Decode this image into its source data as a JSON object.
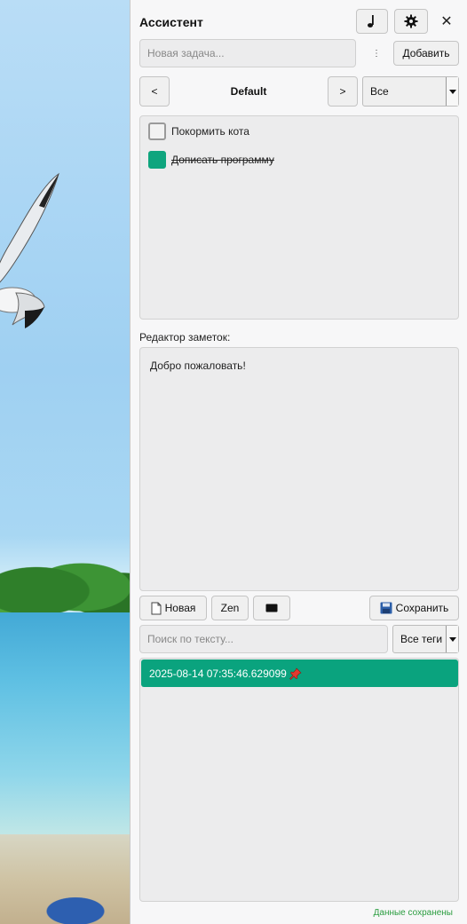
{
  "assistant": {
    "title": "Ассистент",
    "close_glyph": "✕",
    "music_icon": "music-note-icon",
    "settings_icon": "gear-icon"
  },
  "task_input": {
    "placeholder": "Новая задача...",
    "menu_glyph": "⋮",
    "add_label": "Добавить"
  },
  "context": {
    "prev_label": "<",
    "name": "Default",
    "next_label": ">",
    "filter_value": "Все"
  },
  "tasks": [
    {
      "text": "Покормить кота",
      "done": false
    },
    {
      "text": "Дописать программу",
      "done": true
    }
  ],
  "notes": {
    "editor_label": "Редактор заметок:",
    "content": "Добро пожаловать!",
    "new_label": "Новая",
    "zen_label": "Zen",
    "save_label": "Сохранить",
    "search_placeholder": "Поиск по тексту...",
    "tags_value": "Все теги",
    "items": [
      {
        "title": "2025-08-14 07:35:46.629099",
        "pinned": true
      }
    ]
  },
  "status": {
    "message": "Данные сохранены"
  },
  "colors": {
    "accent": "#0aa37e",
    "status": "#2a9d3f"
  }
}
